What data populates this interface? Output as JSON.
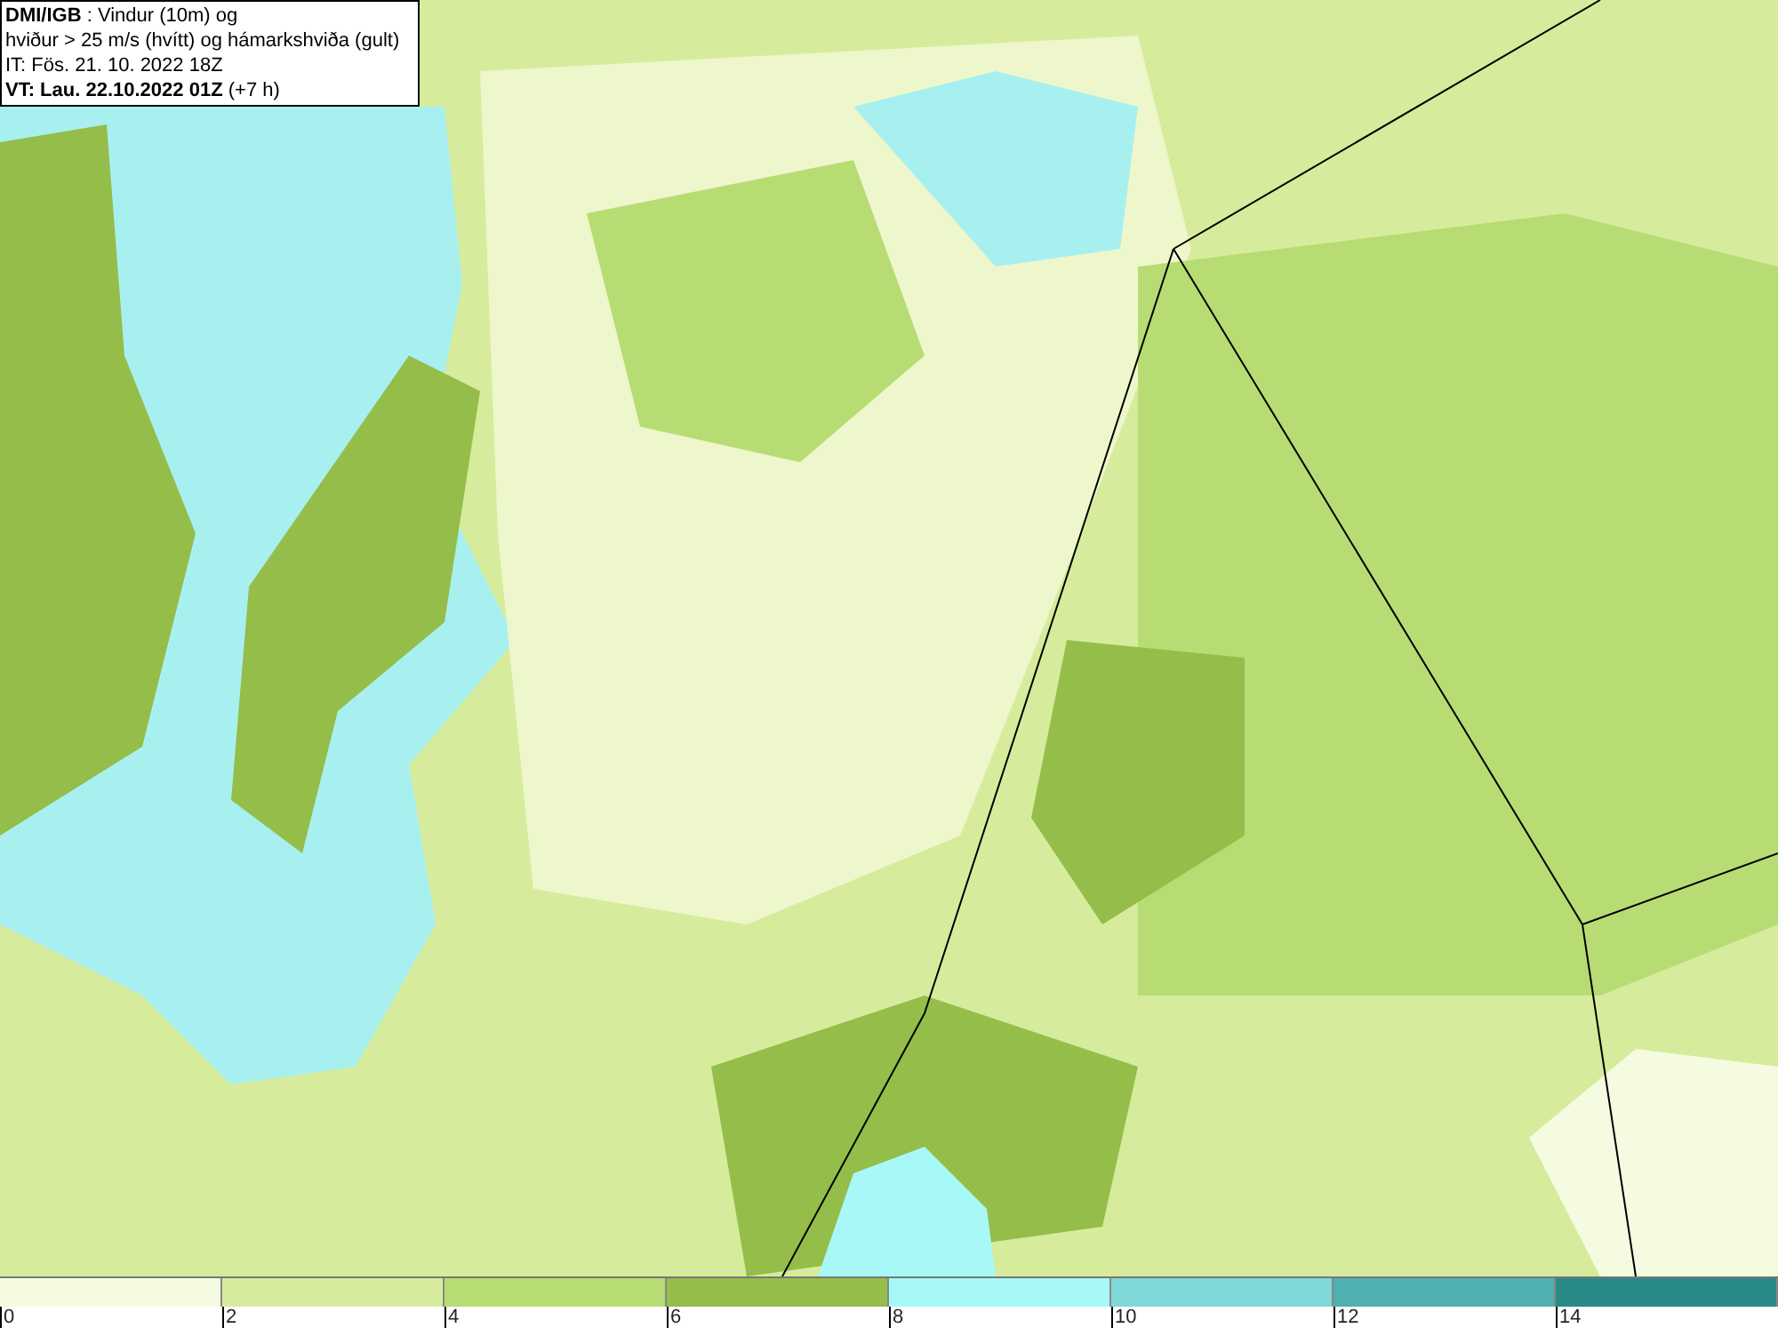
{
  "info_box": {
    "lines": [
      "**DMI/IGB** : Vindur (10m) og",
      "hviður > 25 m/s (hvítt) og hámarkshviða (gult)",
      "IT: Fös. 21. 10. 2022 18Z",
      "**VT: Lau. 22.10.2022 01Z** (+7 h)"
    ]
  },
  "legend": {
    "bins": [
      {
        "label": "0",
        "color": "#f5fbe0"
      },
      {
        "label": "2",
        "color": "#d6ec9c"
      },
      {
        "label": "4",
        "color": "#b8dc74"
      },
      {
        "label": "6",
        "color": "#95bd4a"
      },
      {
        "label": "8",
        "color": "#a8f8f8"
      },
      {
        "label": "10",
        "color": "#80d8d8"
      },
      {
        "label": "12",
        "color": "#50b0b0"
      },
      {
        "label": "14",
        "color": "#2a8a88"
      }
    ]
  }
}
